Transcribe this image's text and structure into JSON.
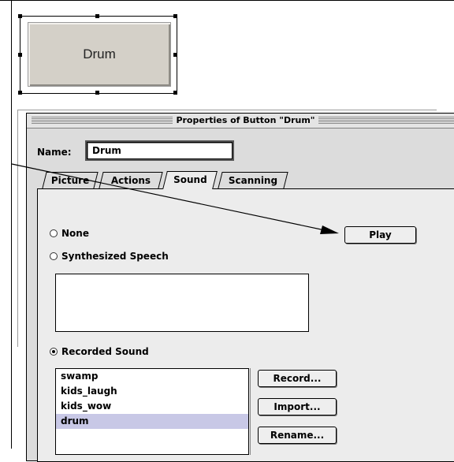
{
  "preview": {
    "button_label": "Drum"
  },
  "dialog": {
    "title": "Properties of Button \"Drum\"",
    "name_label": "Name:",
    "name_value": "Drum",
    "tabs": [
      {
        "label": "Picture",
        "active": false
      },
      {
        "label": "Actions",
        "active": false
      },
      {
        "label": "Sound",
        "active": true
      },
      {
        "label": "Scanning",
        "active": false
      }
    ],
    "sound": {
      "options": [
        {
          "label": "None",
          "checked": false
        },
        {
          "label": "Synthesized Speech",
          "checked": false
        },
        {
          "label": "Recorded Sound",
          "checked": true
        }
      ],
      "speech_text": "",
      "play_label": "Play",
      "recordings": [
        "swamp",
        "kids_laugh",
        "kids_wow",
        "drum"
      ],
      "selected_recording": "drum",
      "record_label": "Record...",
      "import_label": "Import...",
      "rename_label": "Rename..."
    }
  },
  "colors": {
    "list_selection": "#c8c8e6",
    "dialog_bg": "#dcdcdc",
    "preview_button_bg": "#d4d0c8"
  }
}
